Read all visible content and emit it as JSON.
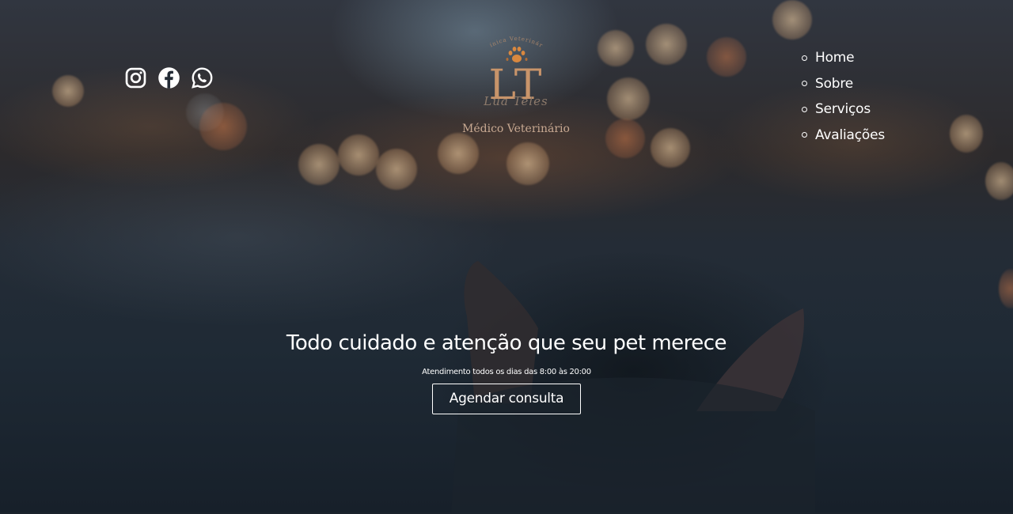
{
  "header": {
    "socials": [
      {
        "icon": "instagram-icon"
      },
      {
        "icon": "facebook-icon"
      },
      {
        "icon": "whatsapp-icon"
      }
    ],
    "logo": {
      "arc_text": "Clínica Veterinária",
      "monogram": "LT",
      "signature": "Lua Teles",
      "subtitle": "Médico Veterinário",
      "colors": {
        "gold": "#c8946a",
        "paw_orange": "#d9883f"
      }
    },
    "nav": {
      "items": [
        {
          "label": "Home"
        },
        {
          "label": "Sobre"
        },
        {
          "label": "Serviços"
        },
        {
          "label": "Avaliações"
        }
      ]
    }
  },
  "hero": {
    "title": "Todo cuidado e atenção que seu pet merece",
    "hours": "Atendimento todos os dias das 8:00 às 20:00",
    "cta_label": "Agendar consulta"
  }
}
